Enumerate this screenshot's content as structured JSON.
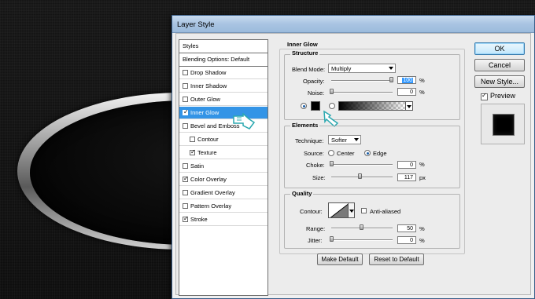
{
  "window": {
    "title": "Layer Style"
  },
  "styles_list": {
    "header": "Styles",
    "blending": "Blending Options: Default",
    "items": [
      {
        "label": "Drop Shadow",
        "checked": false
      },
      {
        "label": "Inner Shadow",
        "checked": false
      },
      {
        "label": "Outer Glow",
        "checked": false
      },
      {
        "label": "Inner Glow",
        "checked": true,
        "selected": true
      },
      {
        "label": "Bevel and Emboss",
        "checked": false
      },
      {
        "label": "Contour",
        "checked": false,
        "indent": true
      },
      {
        "label": "Texture",
        "checked": true,
        "indent": true
      },
      {
        "label": "Satin",
        "checked": false
      },
      {
        "label": "Color Overlay",
        "checked": true
      },
      {
        "label": "Gradient Overlay",
        "checked": false
      },
      {
        "label": "Pattern Overlay",
        "checked": false
      },
      {
        "label": "Stroke",
        "checked": true
      }
    ]
  },
  "panel": {
    "title": "Inner Glow",
    "structure": {
      "title": "Structure",
      "blend_mode_label": "Blend Mode:",
      "blend_mode_value": "Multiply",
      "opacity_label": "Opacity:",
      "opacity_value": "100",
      "opacity_unit": "%",
      "opacity_fraction": 1.0,
      "noise_label": "Noise:",
      "noise_value": "0",
      "noise_unit": "%",
      "noise_fraction": 0.0,
      "color_mode": "solid",
      "color": "#000000"
    },
    "elements": {
      "title": "Elements",
      "technique_label": "Technique:",
      "technique_value": "Softer",
      "source_label": "Source:",
      "source_center": "Center",
      "source_edge": "Edge",
      "source_selected": "edge",
      "choke_label": "Choke:",
      "choke_value": "0",
      "choke_unit": "%",
      "choke_fraction": 0.0,
      "size_label": "Size:",
      "size_value": "117",
      "size_unit": "px",
      "size_fraction": 0.47
    },
    "quality": {
      "title": "Quality",
      "contour_label": "Contour:",
      "anti_aliased_label": "Anti-aliased",
      "anti_aliased_checked": false,
      "range_label": "Range:",
      "range_value": "50",
      "range_unit": "%",
      "range_fraction": 0.5,
      "jitter_label": "Jitter:",
      "jitter_value": "0",
      "jitter_unit": "%",
      "jitter_fraction": 0.0
    },
    "make_default": "Make Default",
    "reset_to_default": "Reset to Default"
  },
  "buttons": {
    "ok": "OK",
    "cancel": "Cancel",
    "new_style": "New Style...",
    "preview_label": "Preview",
    "preview_checked": true
  },
  "colors": {
    "selection": "#3394e6",
    "title_bar": "#a9c4e2",
    "default_button": "#bee6fd"
  }
}
